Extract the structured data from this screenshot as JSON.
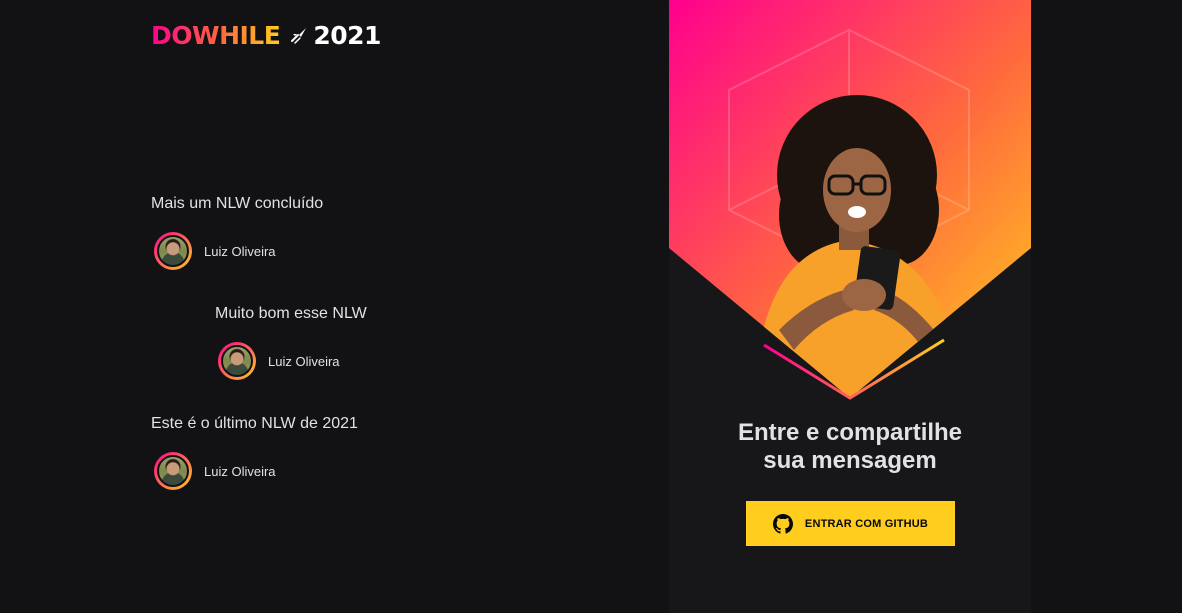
{
  "logo": {
    "brand": "DOWHILE",
    "year": "2021",
    "rocket_icon": "rocket-icon"
  },
  "messages": [
    {
      "text": "Mais um NLW concluído",
      "user": "Luiz Oliveira"
    },
    {
      "text": "Muito bom esse NLW",
      "user": "Luiz Oliveira"
    },
    {
      "text": "Este é o último NLW de 2021",
      "user": "Luiz Oliveira"
    }
  ],
  "signin": {
    "title_line1": "Entre e compartilhe",
    "title_line2": "sua mensagem",
    "button_label": "ENTRAR COM GITHUB",
    "button_icon": "github-icon"
  },
  "colors": {
    "background": "#121214",
    "panel": "#17171a",
    "accent_pink": "#ff008e",
    "accent_orange": "#ff6a3d",
    "accent_yellow": "#ffcd1e",
    "text": "#e1e1e6"
  }
}
